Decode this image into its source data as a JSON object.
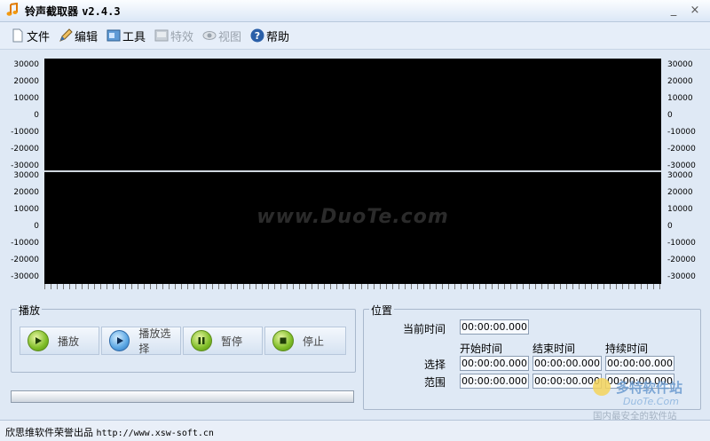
{
  "window": {
    "title": "铃声截取器",
    "version": "v2.4.3",
    "minimize": "_",
    "close": "×"
  },
  "menu": [
    {
      "label": "文件",
      "icon": "file-icon",
      "disabled": false
    },
    {
      "label": "编辑",
      "icon": "edit-icon",
      "disabled": false
    },
    {
      "label": "工具",
      "icon": "tools-icon",
      "disabled": false
    },
    {
      "label": "特效",
      "icon": "effects-icon",
      "disabled": true
    },
    {
      "label": "视图",
      "icon": "view-icon",
      "disabled": true
    },
    {
      "label": "帮助",
      "icon": "help-icon",
      "disabled": false
    }
  ],
  "waveform": {
    "y_labels_top": [
      "30000",
      "20000",
      "10000",
      "0",
      "-10000",
      "-20000",
      "-30000"
    ],
    "y_labels_bottom": [
      "30000",
      "20000",
      "10000",
      "0",
      "-10000",
      "-20000",
      "-30000"
    ],
    "watermark": "www.DuoTe.com"
  },
  "playback": {
    "group_title": "播放",
    "buttons": [
      {
        "label": "播放",
        "icon": "play-icon"
      },
      {
        "label": "播放选择",
        "icon": "play-selection-icon"
      },
      {
        "label": "暂停",
        "icon": "pause-icon"
      },
      {
        "label": "停止",
        "icon": "stop-icon"
      }
    ]
  },
  "position": {
    "group_title": "位置",
    "current_time_label": "当前时间",
    "current_time": "00:00:00.000",
    "col_start": "开始时间",
    "col_end": "结束时间",
    "col_duration": "持续时间",
    "row_label_1": "选择",
    "row_label_2": "范围",
    "selection": {
      "start": "00:00:00.000",
      "end": "00:00:00.000",
      "duration": "00:00:00.000"
    },
    "range": {
      "start": "00:00:00.000",
      "end": "00:00:00.000",
      "duration": "00:00:00.000"
    }
  },
  "progress": 0,
  "status": {
    "text": "欣思维软件荣誉出品",
    "url": "http://www.xsw-soft.cn"
  },
  "corner_logo": {
    "brand": "多特软件站",
    "site": "DuoTe.Com",
    "slogan": "国内最安全的软件站"
  }
}
